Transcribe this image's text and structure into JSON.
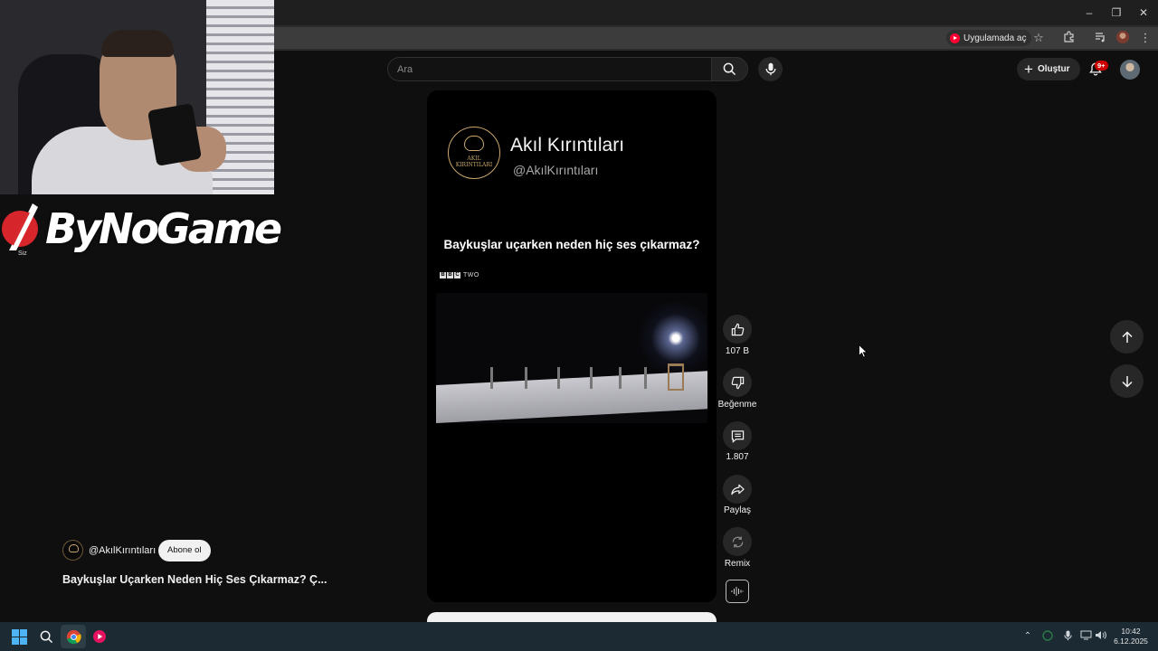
{
  "browser": {
    "open_in_app_label": "Uygulamada aç"
  },
  "header": {
    "search_placeholder": "Ara",
    "create_label": "Oluştur",
    "notification_badge": "9+"
  },
  "overlay": {
    "brand_text": "ByNoGame",
    "small_label": "Siz"
  },
  "short": {
    "card_channel_name": "Akıl Kırıntıları",
    "card_channel_handle": "@AkılKırıntıları",
    "logo_text_top": "AKIL",
    "logo_text_bottom": "KIRINTILARI",
    "question": "Baykuşlar uçarken neden hiç ses çıkarmaz?",
    "broadcaster_letters": [
      "B",
      "B",
      "C"
    ],
    "broadcaster_suffix": "TWO"
  },
  "actions": {
    "like_count": "107 B",
    "dislike_label": "Beğenme",
    "comment_count": "1.807",
    "share_label": "Paylaş",
    "remix_label": "Remix"
  },
  "channel": {
    "handle": "@AkılKırıntıları",
    "subscribe_label": "Abone ol",
    "video_title": "Baykuşlar Uçarken Neden Hiç Ses Çıkarmaz? Ç..."
  },
  "taskbar": {
    "time": "10:42",
    "date": "6.12.2025"
  },
  "colors": {
    "background": "#0f0f0f",
    "youtube_red": "#ff0033",
    "taskbar": "#1b2a33",
    "logo_gold": "#c9a66b"
  }
}
